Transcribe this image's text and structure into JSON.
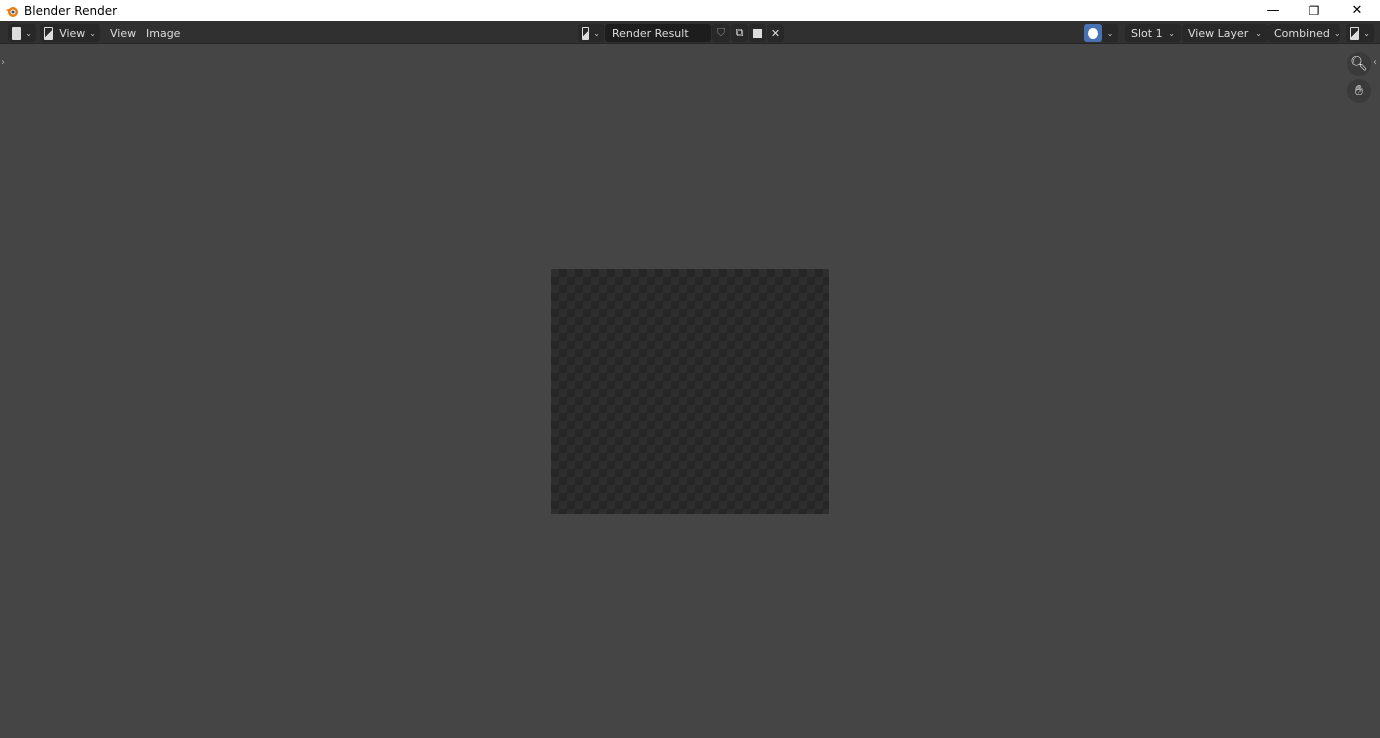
{
  "window": {
    "title": "Blender Render",
    "minimize": "—",
    "restore": "❐",
    "close": "✕"
  },
  "header": {
    "editor_type_icon": "image-editor-icon",
    "view_mode": "View",
    "menus": [
      "View",
      "Image"
    ],
    "image_name": "Render Result",
    "slot": "Slot 1",
    "view_layer": "View Layer",
    "pass": "Combined"
  },
  "accent": "#4772b3",
  "checker_colors": [
    "#2e2e2e",
    "#262626"
  ],
  "background": "#454545"
}
